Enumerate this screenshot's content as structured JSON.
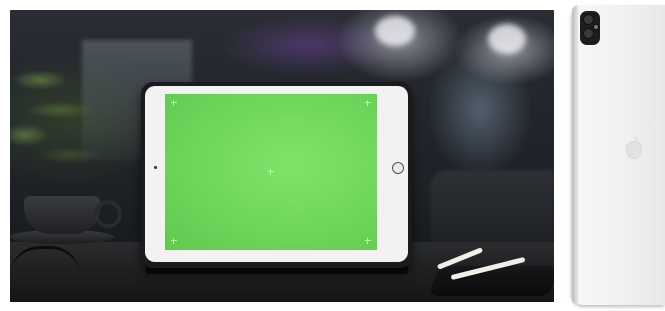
{
  "images": {
    "left_photo": {
      "subject": "ipad-green-screen-cafe"
    },
    "right_photo": {
      "subject": "ipad-pro-rear-silver"
    }
  },
  "colors": {
    "screen_green": "#6dd55a",
    "bezel_white": "#f2f2f2",
    "case_black": "#1b1b1d",
    "device_silver": "#f1f1f1"
  },
  "icons": [
    "home-button-icon",
    "apple-logo-icon",
    "camera-module-icon"
  ]
}
